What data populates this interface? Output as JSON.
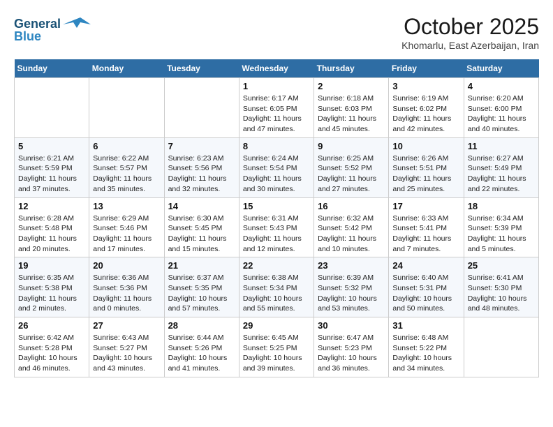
{
  "logo": {
    "line1": "General",
    "line2": "Blue"
  },
  "title": "October 2025",
  "subtitle": "Khomarlu, East Azerbaijan, Iran",
  "days_of_week": [
    "Sunday",
    "Monday",
    "Tuesday",
    "Wednesday",
    "Thursday",
    "Friday",
    "Saturday"
  ],
  "weeks": [
    [
      {
        "day": null,
        "info": null
      },
      {
        "day": null,
        "info": null
      },
      {
        "day": null,
        "info": null
      },
      {
        "day": "1",
        "info": "Sunrise: 6:17 AM\nSunset: 6:05 PM\nDaylight: 11 hours\nand 47 minutes."
      },
      {
        "day": "2",
        "info": "Sunrise: 6:18 AM\nSunset: 6:03 PM\nDaylight: 11 hours\nand 45 minutes."
      },
      {
        "day": "3",
        "info": "Sunrise: 6:19 AM\nSunset: 6:02 PM\nDaylight: 11 hours\nand 42 minutes."
      },
      {
        "day": "4",
        "info": "Sunrise: 6:20 AM\nSunset: 6:00 PM\nDaylight: 11 hours\nand 40 minutes."
      }
    ],
    [
      {
        "day": "5",
        "info": "Sunrise: 6:21 AM\nSunset: 5:59 PM\nDaylight: 11 hours\nand 37 minutes."
      },
      {
        "day": "6",
        "info": "Sunrise: 6:22 AM\nSunset: 5:57 PM\nDaylight: 11 hours\nand 35 minutes."
      },
      {
        "day": "7",
        "info": "Sunrise: 6:23 AM\nSunset: 5:56 PM\nDaylight: 11 hours\nand 32 minutes."
      },
      {
        "day": "8",
        "info": "Sunrise: 6:24 AM\nSunset: 5:54 PM\nDaylight: 11 hours\nand 30 minutes."
      },
      {
        "day": "9",
        "info": "Sunrise: 6:25 AM\nSunset: 5:52 PM\nDaylight: 11 hours\nand 27 minutes."
      },
      {
        "day": "10",
        "info": "Sunrise: 6:26 AM\nSunset: 5:51 PM\nDaylight: 11 hours\nand 25 minutes."
      },
      {
        "day": "11",
        "info": "Sunrise: 6:27 AM\nSunset: 5:49 PM\nDaylight: 11 hours\nand 22 minutes."
      }
    ],
    [
      {
        "day": "12",
        "info": "Sunrise: 6:28 AM\nSunset: 5:48 PM\nDaylight: 11 hours\nand 20 minutes."
      },
      {
        "day": "13",
        "info": "Sunrise: 6:29 AM\nSunset: 5:46 PM\nDaylight: 11 hours\nand 17 minutes."
      },
      {
        "day": "14",
        "info": "Sunrise: 6:30 AM\nSunset: 5:45 PM\nDaylight: 11 hours\nand 15 minutes."
      },
      {
        "day": "15",
        "info": "Sunrise: 6:31 AM\nSunset: 5:43 PM\nDaylight: 11 hours\nand 12 minutes."
      },
      {
        "day": "16",
        "info": "Sunrise: 6:32 AM\nSunset: 5:42 PM\nDaylight: 11 hours\nand 10 minutes."
      },
      {
        "day": "17",
        "info": "Sunrise: 6:33 AM\nSunset: 5:41 PM\nDaylight: 11 hours\nand 7 minutes."
      },
      {
        "day": "18",
        "info": "Sunrise: 6:34 AM\nSunset: 5:39 PM\nDaylight: 11 hours\nand 5 minutes."
      }
    ],
    [
      {
        "day": "19",
        "info": "Sunrise: 6:35 AM\nSunset: 5:38 PM\nDaylight: 11 hours\nand 2 minutes."
      },
      {
        "day": "20",
        "info": "Sunrise: 6:36 AM\nSunset: 5:36 PM\nDaylight: 11 hours\nand 0 minutes."
      },
      {
        "day": "21",
        "info": "Sunrise: 6:37 AM\nSunset: 5:35 PM\nDaylight: 10 hours\nand 57 minutes."
      },
      {
        "day": "22",
        "info": "Sunrise: 6:38 AM\nSunset: 5:34 PM\nDaylight: 10 hours\nand 55 minutes."
      },
      {
        "day": "23",
        "info": "Sunrise: 6:39 AM\nSunset: 5:32 PM\nDaylight: 10 hours\nand 53 minutes."
      },
      {
        "day": "24",
        "info": "Sunrise: 6:40 AM\nSunset: 5:31 PM\nDaylight: 10 hours\nand 50 minutes."
      },
      {
        "day": "25",
        "info": "Sunrise: 6:41 AM\nSunset: 5:30 PM\nDaylight: 10 hours\nand 48 minutes."
      }
    ],
    [
      {
        "day": "26",
        "info": "Sunrise: 6:42 AM\nSunset: 5:28 PM\nDaylight: 10 hours\nand 46 minutes."
      },
      {
        "day": "27",
        "info": "Sunrise: 6:43 AM\nSunset: 5:27 PM\nDaylight: 10 hours\nand 43 minutes."
      },
      {
        "day": "28",
        "info": "Sunrise: 6:44 AM\nSunset: 5:26 PM\nDaylight: 10 hours\nand 41 minutes."
      },
      {
        "day": "29",
        "info": "Sunrise: 6:45 AM\nSunset: 5:25 PM\nDaylight: 10 hours\nand 39 minutes."
      },
      {
        "day": "30",
        "info": "Sunrise: 6:47 AM\nSunset: 5:23 PM\nDaylight: 10 hours\nand 36 minutes."
      },
      {
        "day": "31",
        "info": "Sunrise: 6:48 AM\nSunset: 5:22 PM\nDaylight: 10 hours\nand 34 minutes."
      },
      {
        "day": null,
        "info": null
      }
    ]
  ]
}
